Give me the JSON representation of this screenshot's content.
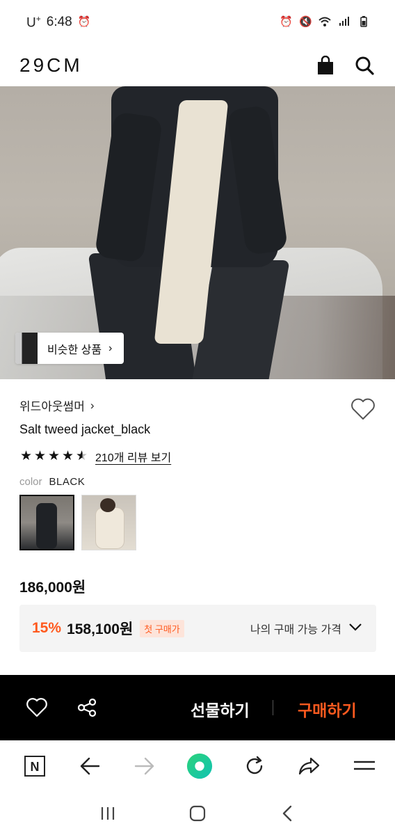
{
  "status_bar": {
    "carrier": "U",
    "carrier_sup": "+",
    "time": "6:48"
  },
  "header": {
    "logo": "29CM",
    "icons": [
      "shopping-bag-icon",
      "search-icon"
    ]
  },
  "hero": {
    "similar_products_label": "비슷한 상품",
    "similar_products_chevron": "›"
  },
  "product": {
    "brand": "위드아웃썸머",
    "brand_chevron": "›",
    "name": "Salt tweed jacket_black",
    "rating": 4.5,
    "review_link": "210개 리뷰 보기",
    "color_key": "color",
    "color_value": "BLACK",
    "swatches": [
      {
        "name": "black",
        "selected": true
      },
      {
        "name": "ivory",
        "selected": false
      }
    ],
    "price": "186,000원",
    "discount": {
      "percent": "15%",
      "price": "158,100원",
      "badge": "첫 구매가",
      "my_price_label": "나의 구매 가능 가격"
    }
  },
  "action_bar": {
    "gift_label": "선물하기",
    "buy_label": "구매하기",
    "accent_color": "#ff5a1f"
  },
  "browser_bar": {
    "n_label": "N",
    "icons": [
      "naver-n-icon",
      "back-arrow-icon",
      "forward-arrow-icon",
      "home-circle-icon",
      "refresh-icon",
      "share-icon",
      "menu-icon"
    ]
  },
  "system_nav": {
    "icons": [
      "recent-apps-icon",
      "home-icon",
      "back-icon"
    ]
  }
}
